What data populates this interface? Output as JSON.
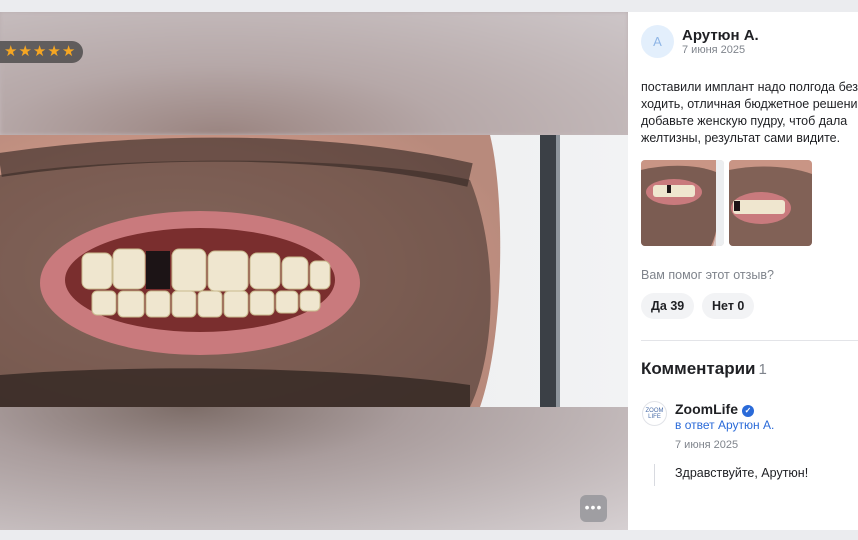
{
  "photo": {
    "rating_stars": 5,
    "more_icon": "more-horizontal-icon"
  },
  "review": {
    "avatar_initial": "А",
    "author": "Арутюн А.",
    "date": "7 июня 2025",
    "text": "поставили имплант надо полгода без ходить, отличная бюджетное решение добавьте женскую пудру, чтоб дала желтизны, результат сами видите.",
    "thumbnails_count": 2
  },
  "helpful": {
    "question": "Вам помог этот отзыв?",
    "yes_label": "Да 39",
    "no_label": "Нет 0"
  },
  "comments": {
    "title": "Комментарии",
    "count": "1",
    "items": [
      {
        "logo_text": "ZOOM LIFE",
        "author": "ZoomLife",
        "verified": true,
        "reply_to": "в ответ Арутюн А.",
        "date": "7 июня 2025",
        "text": "Здравствуйте, Арутюн!"
      }
    ]
  },
  "colors": {
    "accent": "#2a6ad8",
    "star": "#f5a623",
    "muted": "#7f848c"
  }
}
